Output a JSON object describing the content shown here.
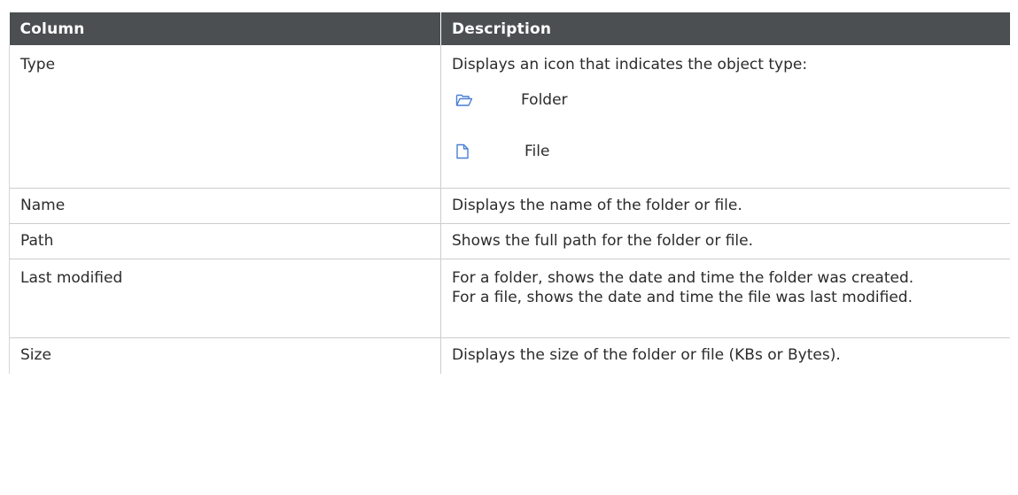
{
  "table": {
    "headers": [
      "Column",
      "Description"
    ],
    "rows": [
      {
        "column": "Type",
        "description": "Displays an icon that indicates the object type:",
        "icons": [
          {
            "icon": "folder-icon",
            "label": "Folder"
          },
          {
            "icon": "file-icon",
            "label": "File"
          }
        ]
      },
      {
        "column": "Name",
        "description": "Displays the name of the folder or file."
      },
      {
        "column": "Path",
        "description": "Shows the full path for the folder or file."
      },
      {
        "column": "Last modified",
        "description_lines": [
          "For a folder, shows the date and time the folder was created.",
          "For a file, shows the date and time the file was last modified."
        ]
      },
      {
        "column": "Size",
        "description": "Displays the size of the folder or file (KBs or Bytes)."
      }
    ]
  },
  "colors": {
    "header_bg": "#4c4f52",
    "header_text": "#ffffff",
    "icon_blue": "#4a7fd4"
  }
}
